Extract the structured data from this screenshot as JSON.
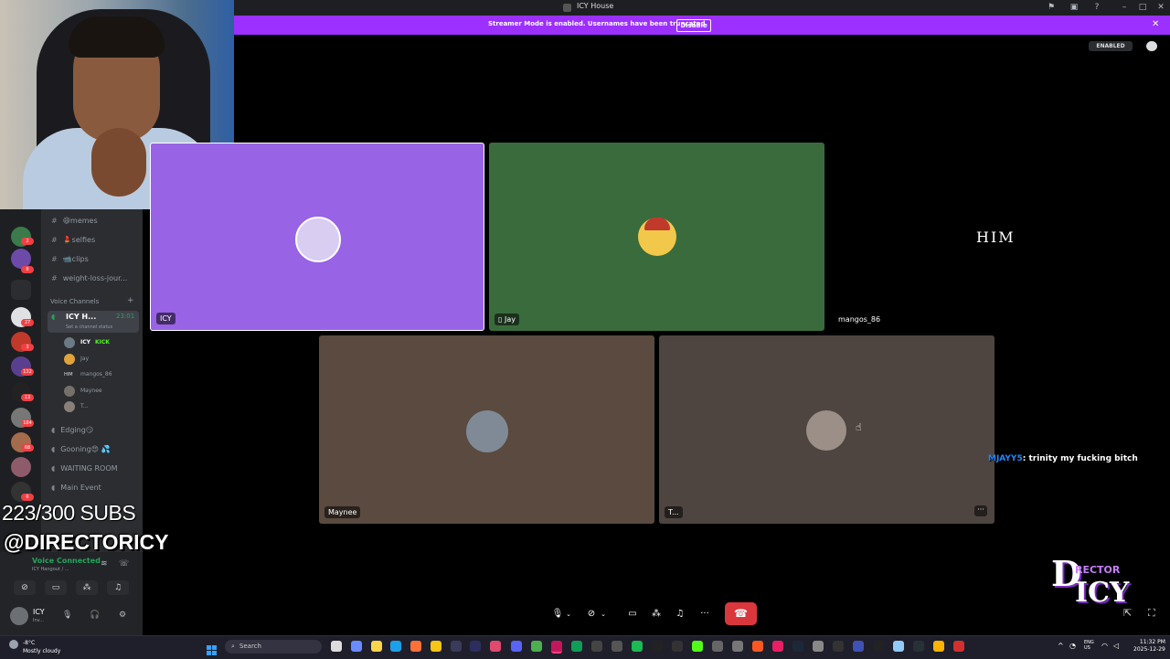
{
  "window": {
    "title": "ICY House"
  },
  "banner": {
    "text": "Streamer Mode is enabled. Usernames have been truncated.",
    "button": "Disable"
  },
  "header": {
    "enabled_badge": "ENABLED"
  },
  "channels": {
    "text": [
      "memes",
      "selfies",
      "clips",
      "weight-loss-jour..."
    ],
    "text_emoji": [
      "😄",
      "💄",
      "📹",
      ""
    ],
    "voice_header": "Voice Channels",
    "active_voice": {
      "name": "ICY H...",
      "time": "23:01",
      "status": "Set a channel status"
    },
    "voice_users": [
      {
        "name": "ICY",
        "tag": "KICK"
      },
      {
        "name": "Jay"
      },
      {
        "name": "mangos_86",
        "prefix": "HIM"
      },
      {
        "name": "Maynee"
      },
      {
        "name": "T..."
      }
    ],
    "other_voice": [
      "Edging",
      "Gooning",
      "WAITING ROOM",
      "Main Event"
    ],
    "other_voice_emoji": [
      "😏",
      "😍 💦",
      "",
      ""
    ]
  },
  "server_badges": [
    "2",
    "8",
    "27",
    "3",
    "132",
    "13",
    "184",
    "68",
    "6"
  ],
  "overlay": {
    "subs": "223/300 SUBS",
    "handle": "@DIRECTORICY"
  },
  "user_area": {
    "connection": "Voice Connected",
    "connection_sub": "ICY Hangout / ...",
    "username": "ICY",
    "user_status": "Inv..."
  },
  "tiles": [
    {
      "label": "ICY",
      "color": "#9863e4"
    },
    {
      "label": "Jay",
      "color": "#3a6b3d"
    },
    {
      "label": "mangos_86",
      "center_text": "HIM",
      "color": "#000000"
    },
    {
      "label": "Maynee",
      "color": "#5a4a3f"
    },
    {
      "label": "T...",
      "color": "#4e4540"
    }
  ],
  "chat": {
    "user": "MJAYY5",
    "message": ": trinity my fucking bitch"
  },
  "taskbar": {
    "weather_temp": "-8°C",
    "weather_desc": "Mostly cloudy",
    "search_placeholder": "Search",
    "lang_top": "ENG",
    "lang_bottom": "US",
    "time": "11:32 PM",
    "date": "2025-12-29"
  },
  "logo": {
    "line1": "RECTOR",
    "line2": "ICY"
  },
  "colors": {
    "accent": "#9b30ff",
    "hangup": "#da373c",
    "voice_green": "#23a55a",
    "chat_user": "#1e88ff"
  }
}
